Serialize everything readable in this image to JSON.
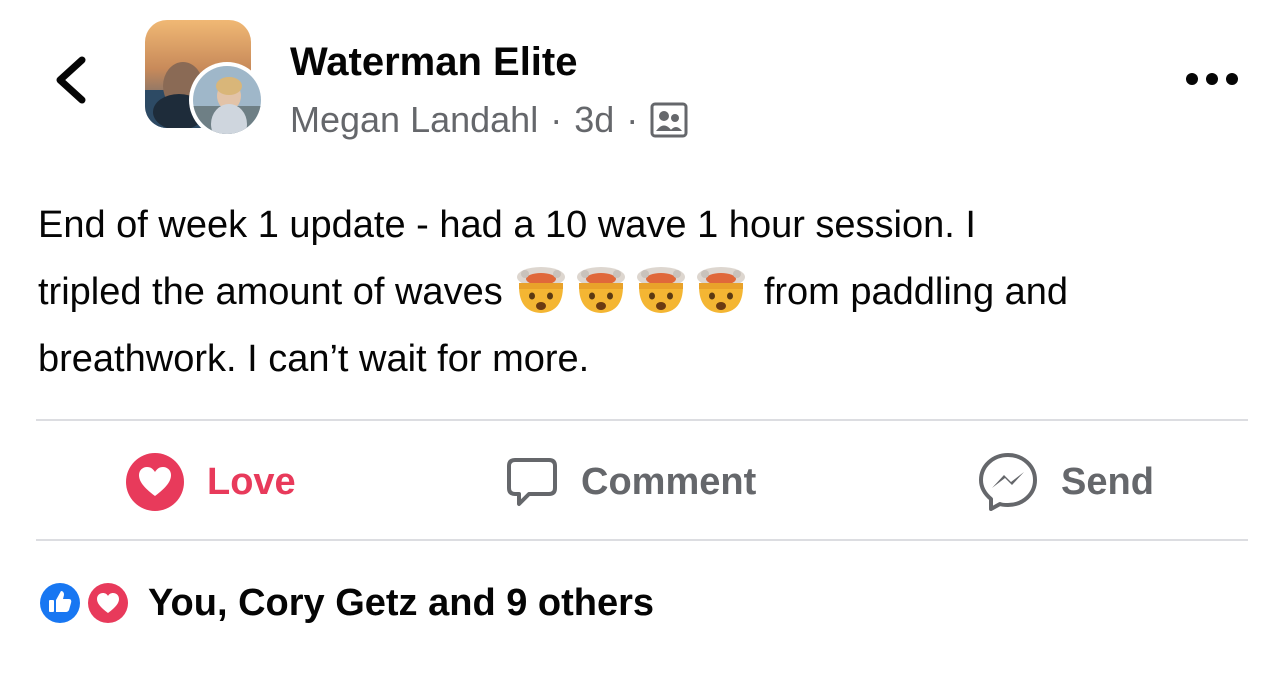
{
  "header": {
    "group_name": "Waterman Elite",
    "author": "Megan Landahl",
    "separator": "·",
    "time": "3d",
    "privacy_icon": "group-members-icon",
    "more_icon": "more-options-icon",
    "back_icon": "chevron-left-icon"
  },
  "post": {
    "line1": "End of week 1 update - had a 10 wave 1 hour session.  I",
    "line2_before": "tripled the amount of waves",
    "line2_after": "from paddling and",
    "line3": "breathwork. I can’t wait for more.",
    "emoji_name": "exploding-head-emoji",
    "emoji_count": 4
  },
  "actions": {
    "love": "Love",
    "comment": "Comment",
    "send": "Send"
  },
  "reactions": {
    "summary": "You, Cory Getz and 9 others",
    "types": [
      "like",
      "love"
    ]
  },
  "colors": {
    "love": "#e83a5b",
    "like": "#1877f2",
    "muted": "#65676b",
    "text": "#050505",
    "divider": "#dcdde1"
  }
}
